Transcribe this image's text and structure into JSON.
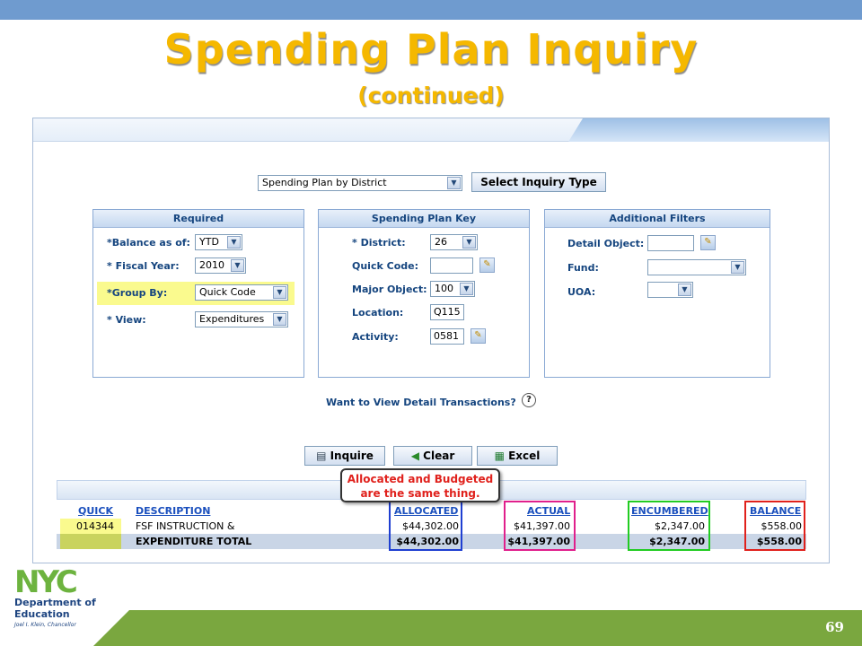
{
  "slide": {
    "title": "Spending Plan Inquiry",
    "subtitle": "(continued)",
    "page_number": "69"
  },
  "inquiry_type": {
    "selected": "Spending Plan by District",
    "button_label": "Select Inquiry Type"
  },
  "required_panel": {
    "title": "Required",
    "fields": [
      {
        "label": "*Balance as of:",
        "value": "YTD"
      },
      {
        "label": "* Fiscal Year:",
        "value": "2010"
      },
      {
        "label": "*Group By:",
        "value": "Quick Code"
      },
      {
        "label": "* View:",
        "value": "Expenditures"
      }
    ]
  },
  "key_panel": {
    "title": "Spending Plan Key",
    "district_label": "* District:",
    "district_value": "26",
    "quick_code_label": "Quick Code:",
    "quick_code_value": "",
    "major_object_label": "Major Object:",
    "major_object_value": "100",
    "location_label": "Location:",
    "location_value": "Q115",
    "activity_label": "Activity:",
    "activity_value": "0581"
  },
  "filters_panel": {
    "title": "Additional Filters",
    "detail_object_label": "Detail Object:",
    "detail_object_value": "",
    "fund_label": "Fund:",
    "fund_value": "",
    "uoa_label": "UOA:",
    "uoa_value": ""
  },
  "detail_question": "Want to View Detail Transactions?",
  "buttons": {
    "inquire": "Inquire",
    "clear": "Clear",
    "excel": "Excel"
  },
  "callout": {
    "line1": "Allocated and Budgeted",
    "line2": "are the same thing."
  },
  "results": {
    "headers": [
      "QUICK",
      "DESCRIPTION",
      "ALLOCATED",
      "ACTUAL",
      "ENCUMBERED",
      "BALANCE"
    ],
    "row": [
      "014344",
      "FSF INSTRUCTION &",
      "$44,302.00",
      "$41,397.00",
      "$2,347.00",
      "$558.00"
    ],
    "total": [
      "",
      "EXPENDITURE TOTAL",
      "$44,302.00",
      "$41,397.00",
      "$2,347.00",
      "$558.00"
    ]
  },
  "logo": {
    "brand": "NYC",
    "line1": "Department of",
    "line2": "Education",
    "line3": "Joel I. Klein, Chancellor"
  },
  "colors": {
    "title": "#f5b800",
    "allocated_frame": "#1f3fd1",
    "actual_frame": "#e0208c",
    "encumbered_frame": "#22cc22",
    "balance_frame": "#e0211c",
    "footer": "#7aa73f"
  }
}
